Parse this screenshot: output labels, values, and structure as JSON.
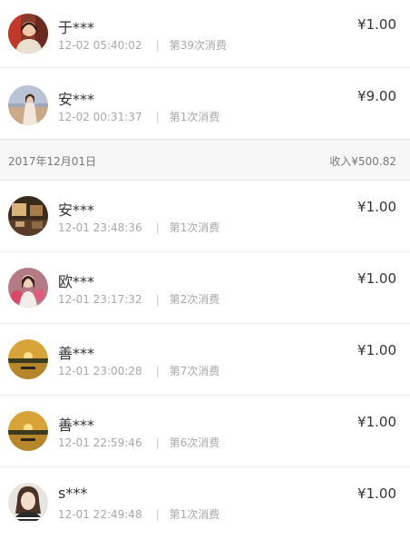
{
  "records_before": [
    {
      "name": "于***",
      "time": "12-02 05:40:02",
      "count": "第39次消费",
      "amount": "¥1.00",
      "avatar": "woman-portrait-red-avatar"
    },
    {
      "name": "安***",
      "time": "12-02 00:31:37",
      "count": "第1次消费",
      "amount": "¥9.00",
      "avatar": "woman-field-avatar"
    }
  ],
  "day_header": {
    "date": "2017年12月01日",
    "income": "收入¥500.82"
  },
  "records_after": [
    {
      "name": "安***",
      "time": "12-01 23:48:36",
      "count": "第1次消费",
      "amount": "¥1.00",
      "avatar": "interior-photo-avatar"
    },
    {
      "name": "欧***",
      "time": "12-01 23:17:32",
      "count": "第2次消费",
      "amount": "¥1.00",
      "avatar": "woman-flowers-avatar"
    },
    {
      "name": "善***",
      "time": "12-01 23:00:28",
      "count": "第7次消费",
      "amount": "¥1.00",
      "avatar": "sunset-lake-avatar"
    },
    {
      "name": "善***",
      "time": "12-01 22:59:46",
      "count": "第6次消费",
      "amount": "¥1.00",
      "avatar": "sunset-lake-avatar"
    },
    {
      "name": "s***",
      "time": "12-01 22:49:48",
      "count": "第1次消费",
      "amount": "¥1.00",
      "avatar": "woman-portrait-avatar"
    }
  ],
  "separator": "|"
}
